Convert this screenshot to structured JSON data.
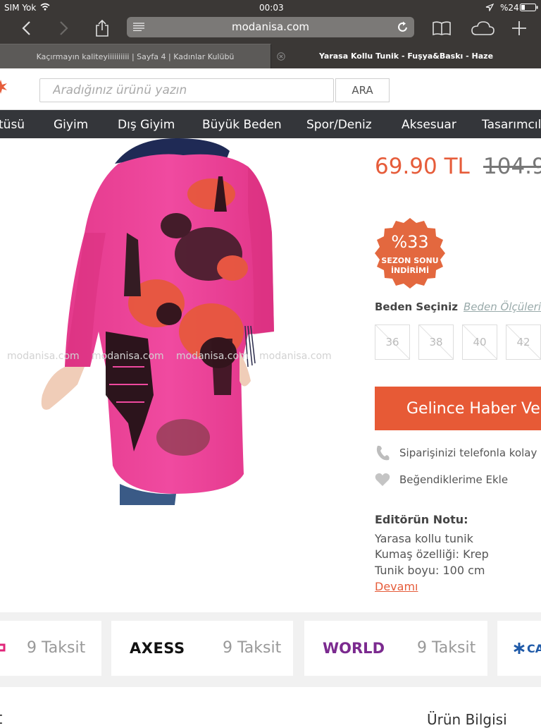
{
  "status_bar": {
    "carrier": "SIM Yok",
    "time": "00:03",
    "battery": "%24"
  },
  "browser": {
    "url": "modanisa.com",
    "tabs": [
      {
        "title": "Kaçırmayın kaliteyiiiiiiiiii | Sayfa 4 | Kadınlar Kulübü"
      },
      {
        "title": "Yarasa Kollu Tunik - Fuşya&Baskı - Haze"
      }
    ]
  },
  "header": {
    "search_placeholder": "Aradığınız ürünü yazın",
    "search_button": "ARA"
  },
  "nav": {
    "items": [
      "tüsü",
      "Giyim",
      "Dış Giyim",
      "Büyük Beden",
      "Spor/Deniz",
      "Aksesuar",
      "Tasarımcıla"
    ]
  },
  "product": {
    "image_alt": "Yarasa Kollu Tunik - Fuşya&Baskı",
    "watermark": "modanisa.com",
    "price_sale": "69.90 TL",
    "price_old": "104.9",
    "discount": {
      "percent": "%33",
      "line1": "SEZON SONU",
      "line2": "İNDİRİMİ"
    },
    "size_label": "Beden Seçiniz",
    "size_chart_link": "Beden Ölçüleri",
    "sizes": [
      "36",
      "38",
      "40",
      "42"
    ],
    "notify_button": "Gelince Haber Ve",
    "phone_order": "Siparişinizi telefonla kolay",
    "favorite": "Beğendiklerime Ekle",
    "editor": {
      "title": "Editörün Notu:",
      "lines": [
        "Yarasa kollu tunik",
        "Kumaş özelliği: Krep",
        "Tunik boyu: 100 cm"
      ],
      "read_more": "Devamı"
    }
  },
  "installments": {
    "label": "9 Taksit",
    "cards": [
      "AXESS",
      "WORLD",
      "CA"
    ]
  },
  "bottom": {
    "left_heading": "t",
    "right_heading": "Ürün Bilgisi"
  }
}
